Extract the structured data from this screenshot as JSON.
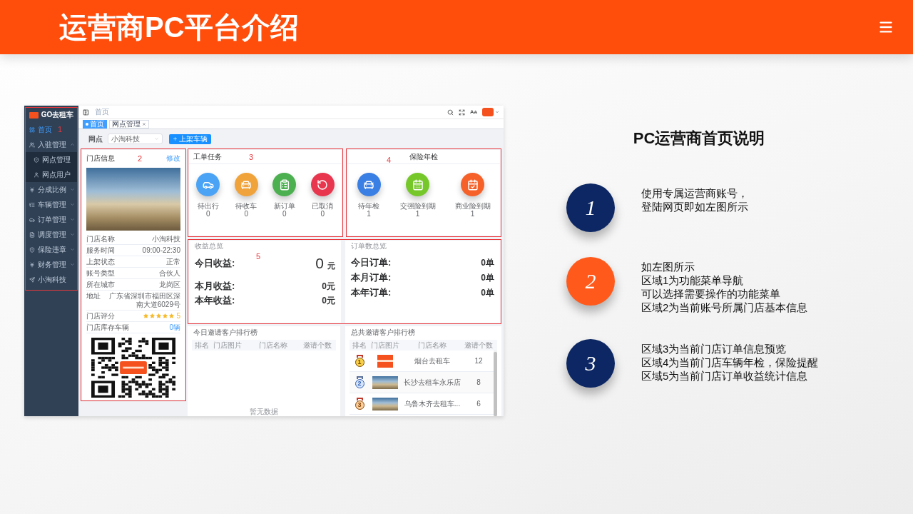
{
  "header": {
    "title": "运营商PC平台介绍"
  },
  "screenshot": {
    "sidebar": {
      "logo_text": "GO去租车",
      "annotation": "1",
      "items": [
        {
          "label": "首页",
          "selected": true
        },
        {
          "label": "入驻管理",
          "selected": false,
          "expanded": true,
          "children": [
            {
              "label": "网点管理",
              "selected": false
            },
            {
              "label": "网点用户",
              "selected": false
            }
          ]
        },
        {
          "label": "分成比例",
          "selected": false,
          "expanded": false
        },
        {
          "label": "车辆管理",
          "selected": false,
          "expanded": false
        },
        {
          "label": "订单管理",
          "selected": false,
          "expanded": false
        },
        {
          "label": "调度管理",
          "selected": false,
          "expanded": false
        },
        {
          "label": "保险违章",
          "selected": false,
          "expanded": false
        },
        {
          "label": "财务管理",
          "selected": false,
          "expanded": false
        },
        {
          "label": "小淘科技",
          "selected": false
        }
      ]
    },
    "navbar": {
      "breadcrumb": "首页"
    },
    "tags": [
      {
        "label": "首页",
        "selected": true
      },
      {
        "label": "网点管理",
        "selected": false
      }
    ],
    "filter": {
      "label": "网点",
      "select_value": "小淘科技",
      "button": "上架车辆"
    },
    "store_card": {
      "title": "门店信息",
      "action": "修改",
      "annotation": "2",
      "fields": [
        {
          "label": "门店名称",
          "value": "小淘科技",
          "kind": "text"
        },
        {
          "label": "服务时间",
          "value": "09:00-22:30",
          "kind": "text"
        },
        {
          "label": "上架状态",
          "value": "正常",
          "kind": "text"
        },
        {
          "label": "账号类型",
          "value": "合伙人",
          "kind": "text"
        },
        {
          "label": "所在城市",
          "value": "龙岗区",
          "kind": "text"
        },
        {
          "label": "地址",
          "value": "广东省深圳市福田区深南大道6029号",
          "kind": "text"
        },
        {
          "label": "门店评分",
          "value": "5",
          "stars": 5,
          "kind": "stars"
        },
        {
          "label": "门店库存车辆",
          "value": "0辆",
          "kind": "link"
        }
      ]
    },
    "task_card": {
      "title": "工单任务",
      "annotation": "3",
      "items": [
        {
          "label": "待出行",
          "count": "0",
          "color": "#4ba3f5"
        },
        {
          "label": "待收车",
          "count": "0",
          "color": "#f0a33a"
        },
        {
          "label": "新订单",
          "count": "0",
          "color": "#4cb050"
        },
        {
          "label": "已取消",
          "count": "0",
          "color": "#e8364f"
        }
      ]
    },
    "inspection_card": {
      "title": "保险年检",
      "annotation": "4",
      "items": [
        {
          "label": "待年检",
          "count": "1",
          "color": "#3a7fe3"
        },
        {
          "label": "交强险到期",
          "count": "1",
          "color": "#76c82a"
        },
        {
          "label": "商业险到期",
          "count": "1",
          "color": "#f6612a"
        }
      ]
    },
    "overview": {
      "annotation": "5",
      "revenue": {
        "title": "收益总览",
        "rows": [
          {
            "label": "今日收益:",
            "value": "0",
            "unit": "元",
            "kind": "large"
          },
          {
            "label": "本月收益:",
            "value": "0元",
            "kind": "normal"
          },
          {
            "label": "本年收益:",
            "value": "0元",
            "kind": "normal"
          }
        ]
      },
      "orders": {
        "title": "订单数总览",
        "rows": [
          {
            "label": "今日订单:",
            "value": "0单",
            "kind": "normal"
          },
          {
            "label": "本月订单:",
            "value": "0单",
            "kind": "normal"
          },
          {
            "label": "本年订单:",
            "value": "0单",
            "kind": "normal"
          }
        ]
      }
    },
    "rank_today": {
      "title": "今日邀请客户排行榜",
      "columns": [
        "排名",
        "门店图片",
        "门店名称",
        "邀请个数"
      ],
      "empty_text": "暂无数据"
    },
    "rank_total": {
      "title": "总共邀请客户排行榜",
      "columns": [
        "排名",
        "门店图片",
        "门店名称",
        "邀请个数"
      ],
      "rows": [
        {
          "rank": "1",
          "kind": "logo",
          "store": "烟台去租车",
          "count": "12"
        },
        {
          "rank": "2",
          "kind": "photo",
          "store": "长沙去租车永乐店",
          "count": "8"
        },
        {
          "rank": "3",
          "kind": "photo",
          "store": "乌鲁木齐去租车...",
          "count": "6"
        }
      ]
    }
  },
  "explanation": {
    "title": "PC运营商首页说明",
    "steps": [
      {
        "number": "1",
        "color": "#0c2763",
        "lines": [
          "使用专属运营商账号，",
          "登陆网页即如左图所示"
        ]
      },
      {
        "number": "2",
        "color": "#ff5a1c",
        "lines": [
          "如左图所示",
          "区域1为功能菜单导航",
          "可以选择需要操作的功能菜单",
          "区域2为当前账号所属门店基本信息"
        ]
      },
      {
        "number": "3",
        "color": "#0c2763",
        "lines": [
          "区域3为当前门店订单信息预览",
          "区域4为当前门店车辆年检，保险提醒",
          "区域5为当前门店订单收益统计信息"
        ]
      }
    ]
  }
}
